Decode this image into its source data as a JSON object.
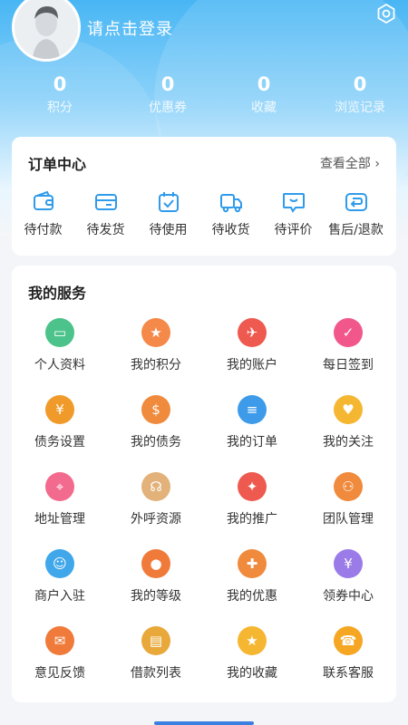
{
  "header": {
    "login_text": "请点击登录",
    "stats": [
      {
        "value": "0",
        "label": "积分"
      },
      {
        "value": "0",
        "label": "优惠券"
      },
      {
        "value": "0",
        "label": "收藏"
      },
      {
        "value": "0",
        "label": "浏览记录"
      }
    ]
  },
  "orders": {
    "title": "订单中心",
    "view_all": "查看全部 ›",
    "items": [
      {
        "label": "待付款",
        "icon": "wallet-icon"
      },
      {
        "label": "待发货",
        "icon": "card-icon"
      },
      {
        "label": "待使用",
        "icon": "calendar-check-icon"
      },
      {
        "label": "待收货",
        "icon": "truck-icon"
      },
      {
        "label": "待评价",
        "icon": "chat-icon"
      },
      {
        "label": "售后/退款",
        "icon": "return-icon"
      }
    ]
  },
  "services": {
    "title": "我的服务",
    "items": [
      {
        "label": "个人资料",
        "icon": "folder-icon",
        "color": "#4cc38a"
      },
      {
        "label": "我的积分",
        "icon": "points-icon",
        "color": "#f5894a"
      },
      {
        "label": "我的账户",
        "icon": "account-icon",
        "color": "#ee5a4f"
      },
      {
        "label": "每日签到",
        "icon": "checkin-icon",
        "color": "#f2578b"
      },
      {
        "label": "债务设置",
        "icon": "debt-settings-icon",
        "color": "#f09a2a"
      },
      {
        "label": "我的债务",
        "icon": "coin-hand-icon",
        "color": "#f08a3c"
      },
      {
        "label": "我的订单",
        "icon": "order-icon",
        "color": "#3d9be9"
      },
      {
        "label": "我的关注",
        "icon": "heart-icon",
        "color": "#f5b731"
      },
      {
        "label": "地址管理",
        "icon": "location-icon",
        "color": "#f26a8d"
      },
      {
        "label": "外呼资源",
        "icon": "headset-icon",
        "color": "#e2b27a"
      },
      {
        "label": "我的推广",
        "icon": "megaphone-icon",
        "color": "#ee5a4f"
      },
      {
        "label": "团队管理",
        "icon": "team-icon",
        "color": "#f08a3c"
      },
      {
        "label": "商户入驻",
        "icon": "merchant-icon",
        "color": "#3fa7ea"
      },
      {
        "label": "我的等级",
        "icon": "medal-icon",
        "color": "#f07a3a"
      },
      {
        "label": "我的优惠",
        "icon": "discount-icon",
        "color": "#f08a3c"
      },
      {
        "label": "领券中心",
        "icon": "coupon-icon",
        "color": "#9b7be8"
      },
      {
        "label": "意见反馈",
        "icon": "feedback-icon",
        "color": "#f07a3a"
      },
      {
        "label": "借款列表",
        "icon": "list-icon",
        "color": "#e8a83a"
      },
      {
        "label": "我的收藏",
        "icon": "star-icon",
        "color": "#f5b731"
      },
      {
        "label": "联系客服",
        "icon": "service-icon",
        "color": "#f5a623"
      }
    ]
  },
  "colors": {
    "accent": "#2f9bea",
    "header_gradient_top": "#48b6f4"
  }
}
